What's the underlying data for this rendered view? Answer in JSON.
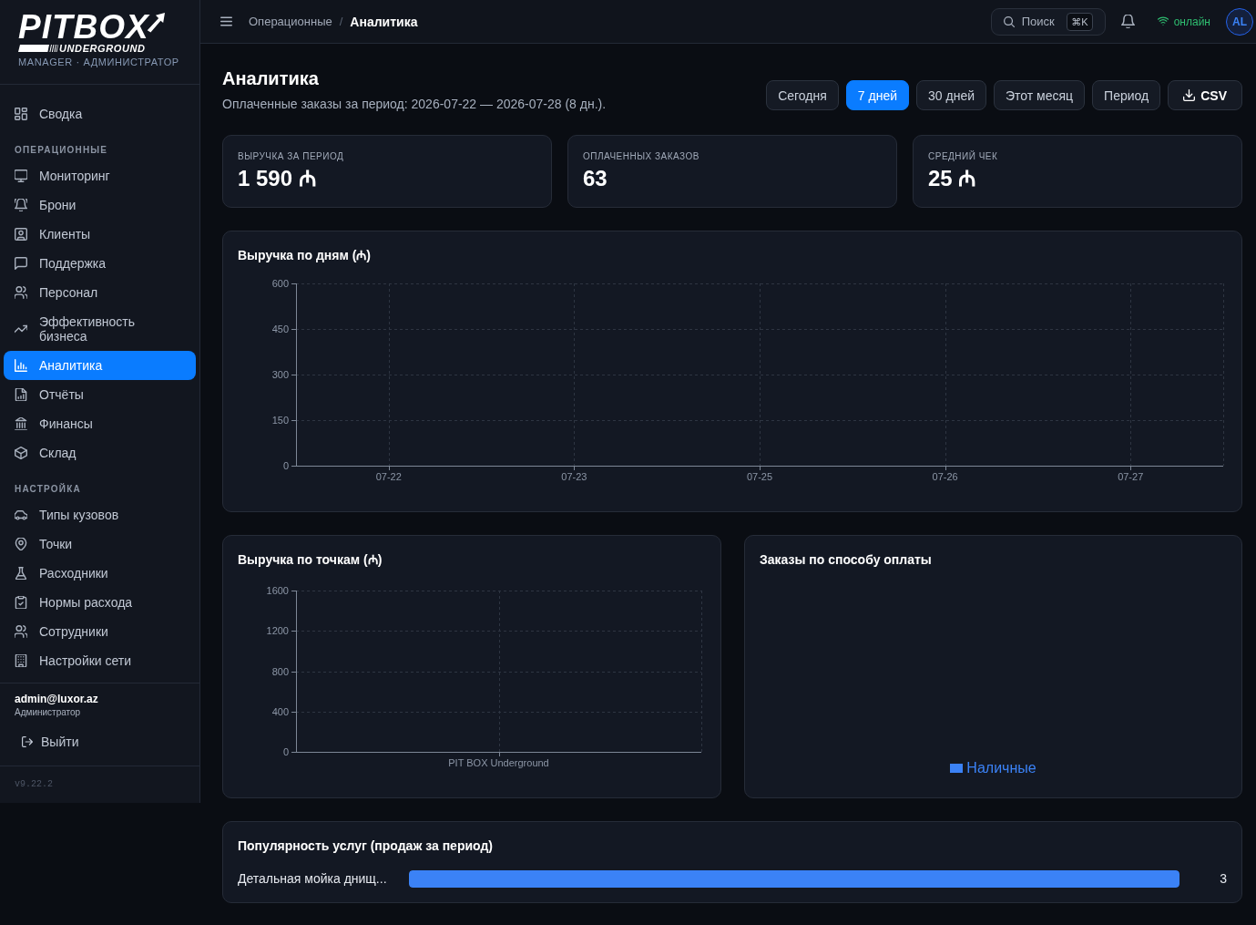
{
  "sidebar": {
    "logo": {
      "wordmark": "PITBOX",
      "subline": "UNDERGROUND"
    },
    "tagline": "MANAGER · АДМИНИСТРАТОР",
    "sections": [
      {
        "items": [
          {
            "label": "Сводка",
            "selected": false
          }
        ]
      },
      {
        "heading": "ОПЕРАЦИОННЫЕ",
        "items": [
          {
            "label": "Мониторинг",
            "selected": false
          },
          {
            "label": "Брони",
            "selected": false
          },
          {
            "label": "Клиенты",
            "selected": false
          },
          {
            "label": "Поддержка",
            "selected": false
          },
          {
            "label": "Персонал",
            "selected": false
          },
          {
            "label": "Эффективность бизнеса",
            "selected": false
          },
          {
            "label": "Аналитика",
            "selected": true
          },
          {
            "label": "Отчёты",
            "selected": false
          },
          {
            "label": "Финансы",
            "selected": false
          },
          {
            "label": "Склад",
            "selected": false
          }
        ]
      },
      {
        "heading": "НАСТРОЙКА",
        "items": [
          {
            "label": "Типы кузовов",
            "selected": false
          },
          {
            "label": "Точки",
            "selected": false
          },
          {
            "label": "Расходники",
            "selected": false
          },
          {
            "label": "Нормы расхода",
            "selected": false
          },
          {
            "label": "Сотрудники",
            "selected": false
          },
          {
            "label": "Настройки сети",
            "selected": false
          }
        ]
      }
    ],
    "user": {
      "email": "admin@luxor.az",
      "role": "Администратор"
    },
    "logout": "Выйти",
    "version": "v9.22.2"
  },
  "topbar": {
    "breadcrumb": [
      {
        "label": "Операционные",
        "current": false
      },
      {
        "label": "Аналитика",
        "current": true
      }
    ],
    "separator": "/",
    "search": {
      "label": "Поиск",
      "shortcut": "⌘K"
    },
    "status": {
      "label": "онлайн",
      "connected": true
    },
    "avatar": {
      "initials": "AL"
    }
  },
  "page": {
    "title": "Аналитика",
    "subtitle": "Оплаченные заказы за период: 2026-07-22 — 2026-07-28 (8 дн.)."
  },
  "range_buttons": [
    {
      "label": "Сегодня",
      "selected": false
    },
    {
      "label": "7 дней",
      "selected": true
    },
    {
      "label": "30 дней",
      "selected": false
    },
    {
      "label": "Этот месяц",
      "selected": false
    },
    {
      "label": "Период",
      "selected": false
    }
  ],
  "export_button": {
    "label": "CSV"
  },
  "stats": [
    {
      "label": "ВЫРУЧКА ЗА ПЕРИОД",
      "value": "1 590 ₼"
    },
    {
      "label": "ОПЛАЧЕННЫХ ЗАКАЗОВ",
      "value": "63"
    },
    {
      "label": "СРЕДНИЙ ЧЕК",
      "value": "25 ₼"
    }
  ],
  "revenue_by_day": {
    "title": "Выручка по дням (₼)",
    "chart_data": {
      "type": "bar",
      "categories": [
        "07-22",
        "07-23",
        "07-25",
        "07-26",
        "07-27"
      ],
      "ylim": [
        0,
        600
      ],
      "yticks": [
        0,
        150,
        300,
        450,
        600
      ],
      "grid": true
    }
  },
  "revenue_by_location": {
    "title": "Выручка по точкам (₼)",
    "chart_data": {
      "type": "bar",
      "categories": [
        "PIT BOX Underground"
      ],
      "ylim": [
        0,
        1600
      ],
      "yticks": [
        0,
        400,
        800,
        1200,
        1600
      ],
      "grid": true
    }
  },
  "orders_by_payment": {
    "title": "Заказы по способу оплаты",
    "legend": [
      {
        "label": "Наличные",
        "color": "#3b82f6"
      }
    ]
  },
  "service_popularity": {
    "title": "Популярность услуг (продаж за период)",
    "rows": [
      {
        "label": "Детальная мойка днищ...",
        "level": 1,
        "count": "3"
      }
    ]
  }
}
